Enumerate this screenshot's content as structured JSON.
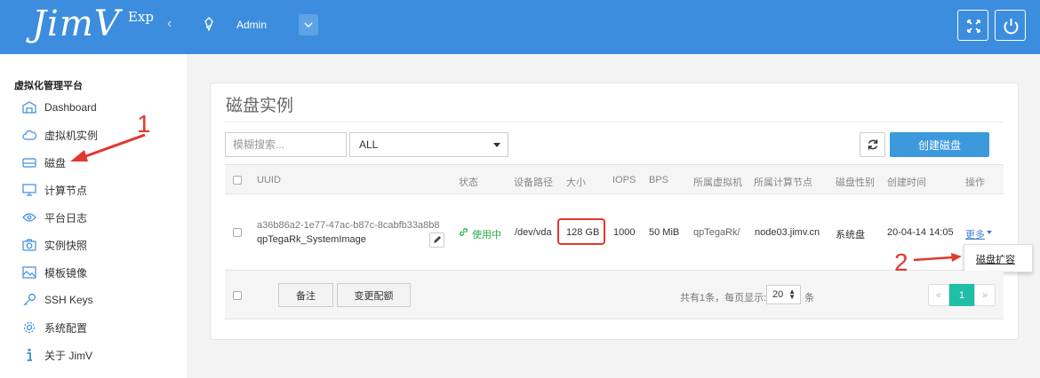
{
  "header": {
    "logo": "JimV",
    "logo_suffix": "Exp",
    "collapse_icon": "‹",
    "user": "Admin",
    "accent": "#3c8dde"
  },
  "sidebar": {
    "title": "虚拟化管理平台",
    "items": [
      {
        "label": "Dashboard",
        "icon": "dashboard-icon"
      },
      {
        "label": "虚拟机实例",
        "icon": "cloud-icon"
      },
      {
        "label": "磁盘",
        "icon": "disk-icon"
      },
      {
        "label": "计算节点",
        "icon": "monitor-icon"
      },
      {
        "label": "平台日志",
        "icon": "eye-icon"
      },
      {
        "label": "实例快照",
        "icon": "camera-icon"
      },
      {
        "label": "模板镜像",
        "icon": "image-icon"
      },
      {
        "label": "SSH Keys",
        "icon": "key-icon"
      },
      {
        "label": "系统配置",
        "icon": "gear-icon"
      },
      {
        "label": "关于 JimV",
        "icon": "info-icon"
      }
    ]
  },
  "main": {
    "title": "磁盘实例",
    "search_placeholder": "模糊搜索...",
    "filter_value": "ALL",
    "create_label": "创建磁盘",
    "columns": [
      "UUID",
      "状态",
      "设备路径",
      "大小",
      "IOPS",
      "BPS",
      "所属虚拟机",
      "所属计算节点",
      "磁盘性别",
      "创建时间",
      "操作"
    ],
    "rows": [
      {
        "uuid": "a36b86a2-1e77-47ac-b87c-8cabfb33a8b8",
        "name": "qpTegaRk_SystemImage",
        "status": "使用中",
        "path": "/dev/vda",
        "size": "128 GB",
        "iops": "1000",
        "bps": "50 MiB",
        "vm": "qpTegaRk/",
        "node": "node03.jimv.cn",
        "disk_type": "系统盘",
        "created": "20-04-14 14:05",
        "action": "更多"
      }
    ],
    "dropdown_item": "磁盘扩容",
    "footer": {
      "note_label": "备注",
      "config_label": "变更配额",
      "total": "共有1条，每页显示:",
      "per_page": "20",
      "unit": "条",
      "prev": "«",
      "page": "1",
      "next": "»"
    }
  },
  "annotations": {
    "one": "1",
    "two": "2",
    "color": "#e2372f"
  }
}
